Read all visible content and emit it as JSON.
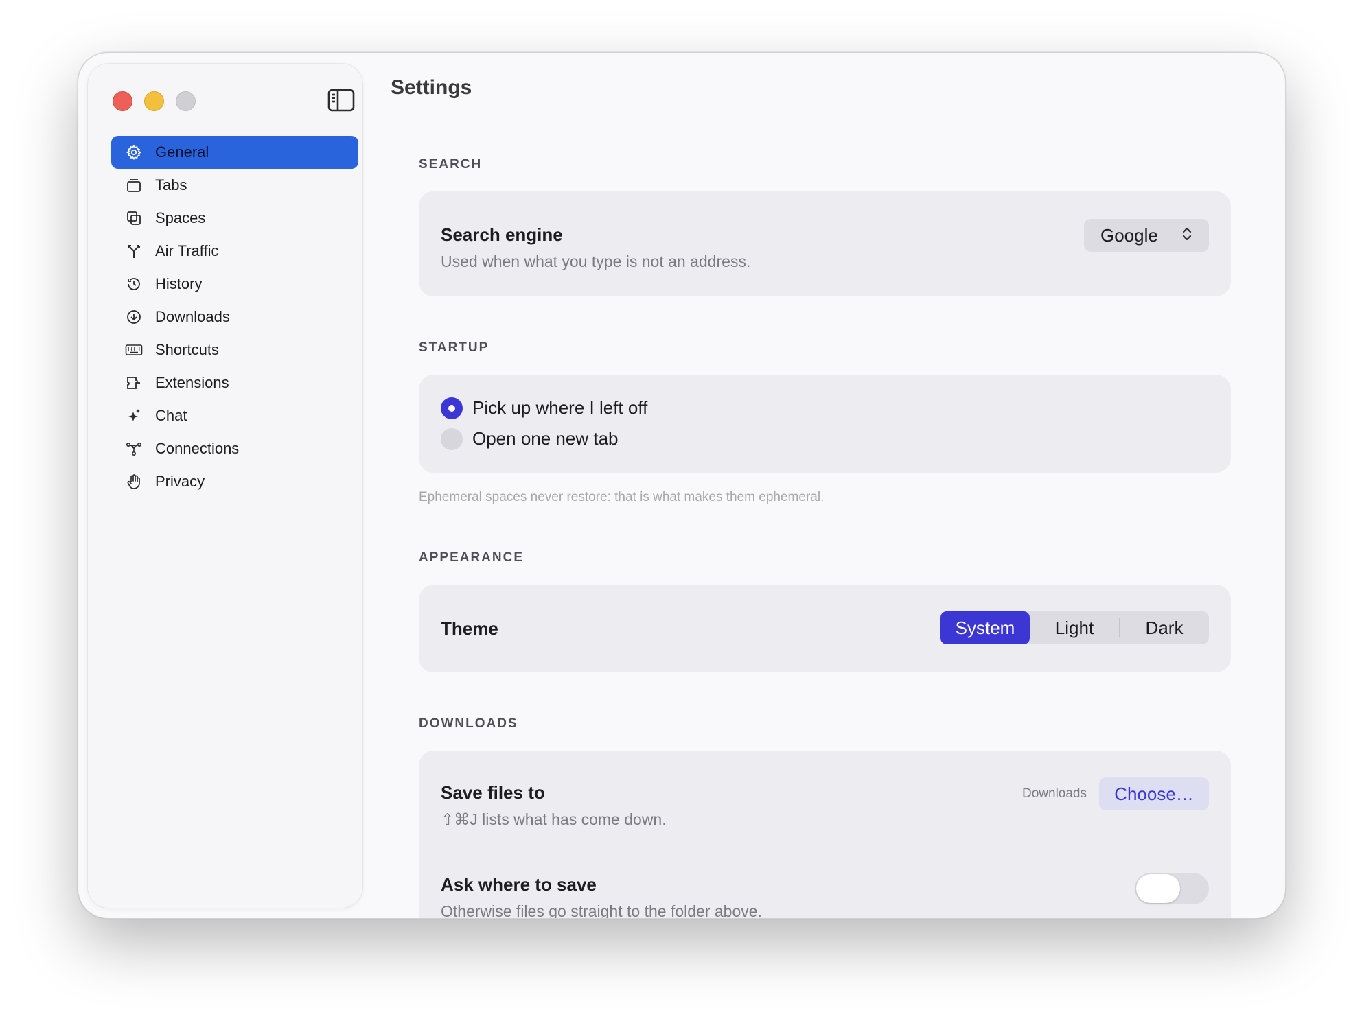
{
  "sidebar": {
    "items": [
      {
        "label": "General",
        "icon": "gear-icon",
        "active": true
      },
      {
        "label": "Tabs",
        "icon": "tabs-icon"
      },
      {
        "label": "Spaces",
        "icon": "spaces-icon"
      },
      {
        "label": "Air Traffic",
        "icon": "air-traffic-icon"
      },
      {
        "label": "History",
        "icon": "history-icon"
      },
      {
        "label": "Downloads",
        "icon": "download-icon"
      },
      {
        "label": "Shortcuts",
        "icon": "keyboard-icon"
      },
      {
        "label": "Extensions",
        "icon": "extensions-icon"
      },
      {
        "label": "Chat",
        "icon": "sparkle-icon"
      },
      {
        "label": "Connections",
        "icon": "connections-icon"
      },
      {
        "label": "Privacy",
        "icon": "hand-icon"
      }
    ]
  },
  "main": {
    "title": "Settings",
    "search": {
      "section": "SEARCH",
      "engine_title": "Search engine",
      "engine_sub": "Used when what you type is not an address.",
      "engine_value": "Google"
    },
    "startup": {
      "section": "STARTUP",
      "options": [
        "Pick up where I left off",
        "Open one new tab"
      ],
      "selected": 0,
      "footnote": "Ephemeral spaces never restore: that is what makes them ephemeral."
    },
    "appearance": {
      "section": "APPEARANCE",
      "theme_title": "Theme",
      "options": [
        "System",
        "Light",
        "Dark"
      ],
      "selected": 0
    },
    "downloads": {
      "section": "DOWNLOADS",
      "save_title": "Save files to",
      "save_sub": "⇧⌘J lists what has come down.",
      "folder": "Downloads",
      "choose_label": "Choose…",
      "ask_title": "Ask where to save",
      "ask_sub": "Otherwise files go straight to the folder above.",
      "ask_enabled": false
    }
  },
  "colors": {
    "accent": "#3b36d4",
    "sidebar_active": "#2a64dc",
    "close": "#ed5f57",
    "minimize": "#f3c03e"
  }
}
